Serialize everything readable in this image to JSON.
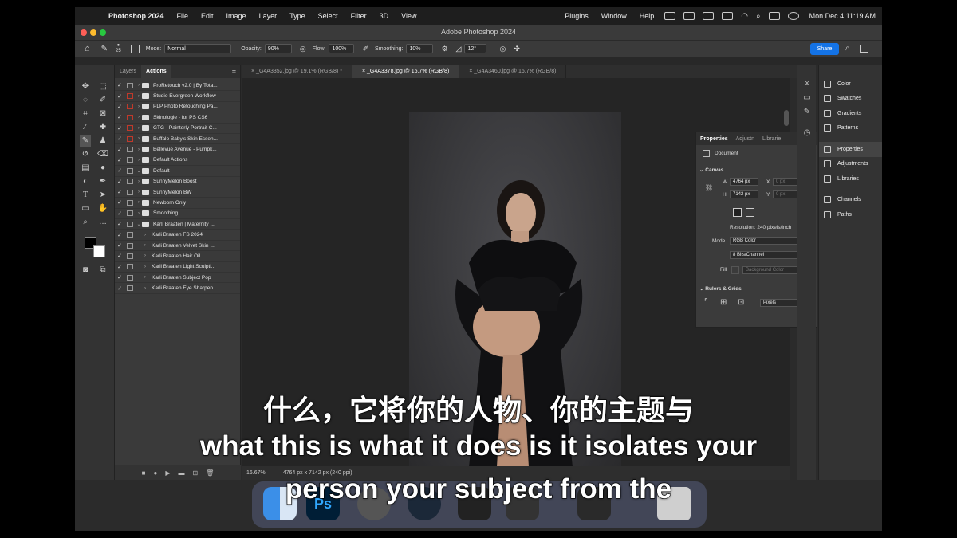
{
  "menubar": {
    "app": "Photoshop 2024",
    "items": [
      "File",
      "Edit",
      "Image",
      "Layer",
      "Type",
      "Select",
      "Filter",
      "3D",
      "View"
    ],
    "right_items": [
      "Plugins",
      "Window",
      "Help"
    ],
    "datetime": "Mon Dec 4  11:19 AM"
  },
  "window": {
    "title": "Adobe Photoshop 2024"
  },
  "options": {
    "brush_size": "25",
    "mode_label": "Mode:",
    "mode_value": "Normal",
    "opacity_label": "Opacity:",
    "opacity_value": "90%",
    "flow_label": "Flow:",
    "flow_value": "100%",
    "smoothing_label": "Smoothing:",
    "smoothing_value": "10%",
    "angle_value": "12°",
    "share_label": "Share"
  },
  "left_panel": {
    "tabs": [
      "Layers",
      "Actions"
    ],
    "actions": [
      {
        "label": "ProRetouch v2.0 | By Tota...",
        "level": 0,
        "type": "set",
        "red": false
      },
      {
        "label": "Studio Evergreen Workflow",
        "level": 0,
        "type": "set",
        "red": true
      },
      {
        "label": "PLP Photo Retouching Pa...",
        "level": 0,
        "type": "set",
        "red": true
      },
      {
        "label": "Skinologie - for PS CS6",
        "level": 0,
        "type": "set",
        "red": true
      },
      {
        "label": "GTG - Painterly Portrait C...",
        "level": 0,
        "type": "set",
        "red": true
      },
      {
        "label": "Buffalo Baby's Skin Essen...",
        "level": 0,
        "type": "set",
        "red": true
      },
      {
        "label": "Bellevue Avenue - Pumpk...",
        "level": 0,
        "type": "set",
        "red": false
      },
      {
        "label": "Default Actions",
        "level": 0,
        "type": "set",
        "red": false
      },
      {
        "label": "Default",
        "level": 0,
        "type": "open",
        "red": false
      },
      {
        "label": "SunnyMelon Boost",
        "level": 0,
        "type": "set",
        "red": false
      },
      {
        "label": "SunnyMelon BW",
        "level": 0,
        "type": "set",
        "red": false
      },
      {
        "label": "Newborn Only",
        "level": 0,
        "type": "set",
        "red": false
      },
      {
        "label": "Smoothing",
        "level": 0,
        "type": "set",
        "red": false
      },
      {
        "label": "Karli Braaten | Maternity ...",
        "level": 0,
        "type": "open",
        "red": false
      },
      {
        "label": "Karli Braaten FS 2024",
        "level": 1,
        "type": "action",
        "red": false
      },
      {
        "label": "Karli Braaten Velvet Skin ...",
        "level": 1,
        "type": "action",
        "red": false
      },
      {
        "label": "Karli Braaten Hair Oil",
        "level": 1,
        "type": "action",
        "red": false
      },
      {
        "label": "Karli Braaten Light Sculpti...",
        "level": 1,
        "type": "action",
        "red": false
      },
      {
        "label": "Karli Braaten Subject Pop",
        "level": 1,
        "type": "action",
        "red": false
      },
      {
        "label": "Karli Braaten Eye Sharpen",
        "level": 1,
        "type": "action",
        "red": false
      }
    ]
  },
  "doc_tabs": [
    {
      "label": "_G4A3352.jpg @ 19.1% (RGB/8) *",
      "active": false
    },
    {
      "label": "_G4A3378.jpg @ 16.7% (RGB/8)",
      "active": true
    },
    {
      "label": "_G4A3460.jpg @ 16.7% (RGB/8)",
      "active": false
    }
  ],
  "status": {
    "zoom": "16.67%",
    "info": "4764 px x 7142 px (240 ppi)"
  },
  "properties": {
    "tabs": [
      "Properties",
      "Adjustn",
      "Librarie"
    ],
    "document": "Document",
    "canvas_title": "Canvas",
    "w_label": "W",
    "w_value": "4764 px",
    "h_label": "H",
    "h_value": "7142 px",
    "x_label": "X",
    "x_value": "0 px",
    "y_label": "Y",
    "y_value": "0 px",
    "resolution": "Resolution: 240 pixels/inch",
    "mode_label": "Mode",
    "mode_value": "RGB Color",
    "bits_value": "8 Bits/Channel",
    "fill_label": "Fill",
    "fill_value": "Background Color",
    "rulers_title": "Rulers & Grids",
    "units_value": "Pixels"
  },
  "right_panels": [
    "Color",
    "Swatches",
    "Gradients",
    "Patterns",
    "Properties",
    "Adjustments",
    "Libraries",
    "Channels",
    "Paths"
  ],
  "subtitles": {
    "zh": "什么，它将你的人物、你的主题与",
    "en1": "what this is what it does is it isolates your",
    "en2": "person your subject from the"
  },
  "colors": {
    "accent": "#1473e6",
    "red_toggle": "#c0392b"
  }
}
